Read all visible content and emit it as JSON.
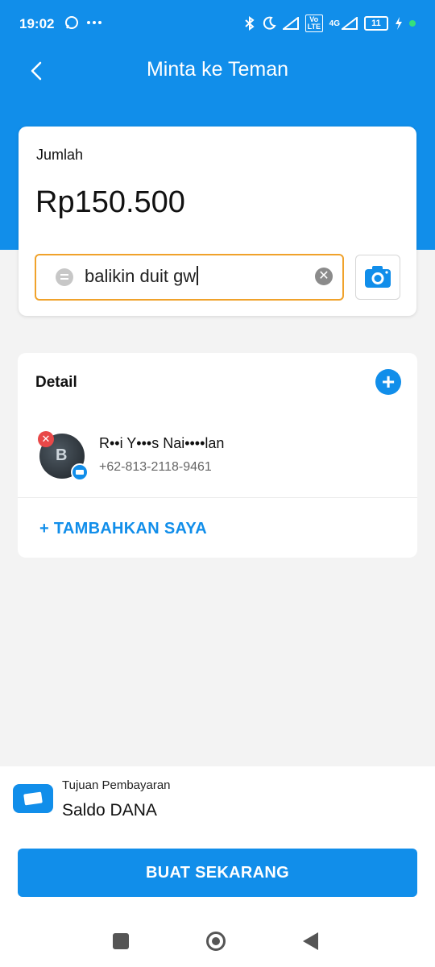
{
  "status_bar": {
    "time": "19:02",
    "battery": "11",
    "left_icons": [
      "whatsapp-icon",
      "more-dots-icon"
    ],
    "right_icons": [
      "bluetooth-icon",
      "moon-icon",
      "signal-icon",
      "volte-icon",
      "4g-signal-icon",
      "battery-icon",
      "charging-icon"
    ],
    "lte_label": "Vo LTE",
    "network_label": "4G"
  },
  "header": {
    "title": "Minta ke Teman"
  },
  "amount_card": {
    "label": "Jumlah",
    "amount": "Rp150.500",
    "note_value": "balikin duit gw"
  },
  "detail": {
    "title": "Detail",
    "contact": {
      "name": "R••i Y•••s Nai••••lan",
      "phone": "+62-813-2118-9461",
      "avatar_letter": "B"
    },
    "add_self_label": "+ TAMBAHKAN SAYA"
  },
  "payment": {
    "label": "Tujuan Pembayaran",
    "value": "Saldo DANA"
  },
  "actions": {
    "create_label": "BUAT SEKARANG"
  },
  "colors": {
    "primary": "#118eea",
    "input_focus": "#f0a22b",
    "remove": "#e84848"
  }
}
